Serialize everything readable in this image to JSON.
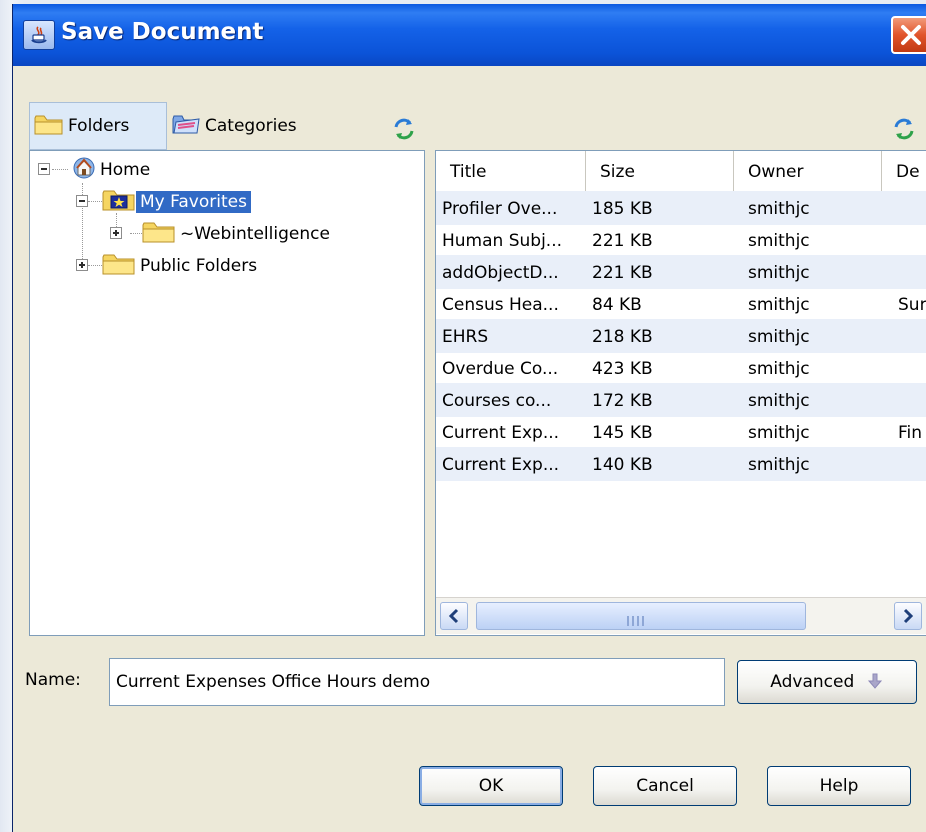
{
  "window": {
    "title": "Save Document",
    "close_glyph": "✕"
  },
  "tabs": [
    {
      "label": "Folders",
      "icon": "folder-icon",
      "selected": true
    },
    {
      "label": "Categories",
      "icon": "categories-icon",
      "selected": false
    }
  ],
  "tree": {
    "root": "Home",
    "nodes": [
      {
        "label": "My Favorites",
        "selected": true,
        "expanded": true
      },
      {
        "label": "~Webintelligence",
        "selected": false,
        "expanded": false
      },
      {
        "label": "Public Folders",
        "selected": false,
        "expanded": false
      }
    ]
  },
  "table": {
    "columns": [
      "Title",
      "Size",
      "Owner",
      "De"
    ],
    "rows": [
      {
        "title": "Profiler Ove...",
        "size": "185 KB",
        "owner": "smithjc",
        "desc": ""
      },
      {
        "title": "Human Subj...",
        "size": "221 KB",
        "owner": "smithjc",
        "desc": ""
      },
      {
        "title": "addObjectD...",
        "size": "221 KB",
        "owner": "smithjc",
        "desc": ""
      },
      {
        "title": "Census Hea...",
        "size": "84 KB",
        "owner": "smithjc",
        "desc": "Sur"
      },
      {
        "title": "EHRS",
        "size": "218 KB",
        "owner": "smithjc",
        "desc": ""
      },
      {
        "title": "Overdue Co...",
        "size": "423 KB",
        "owner": "smithjc",
        "desc": ""
      },
      {
        "title": "Courses co...",
        "size": "172 KB",
        "owner": "smithjc",
        "desc": ""
      },
      {
        "title": "Current Exp...",
        "size": "145 KB",
        "owner": "smithjc",
        "desc": "Fin"
      },
      {
        "title": "Current Exp...",
        "size": "140 KB",
        "owner": "smithjc",
        "desc": ""
      }
    ],
    "scroll_left": "<",
    "scroll_right": ">"
  },
  "name_field": {
    "label": "Name:",
    "value": "Current Expenses Office Hours demo"
  },
  "buttons": {
    "advanced": "Advanced",
    "ok": "OK",
    "cancel": "Cancel",
    "help": "Help"
  },
  "colors": {
    "titlebar": "#0a58e0",
    "selection": "#316ac5",
    "row_alt": "#e9eff9",
    "close": "#e1542b"
  }
}
